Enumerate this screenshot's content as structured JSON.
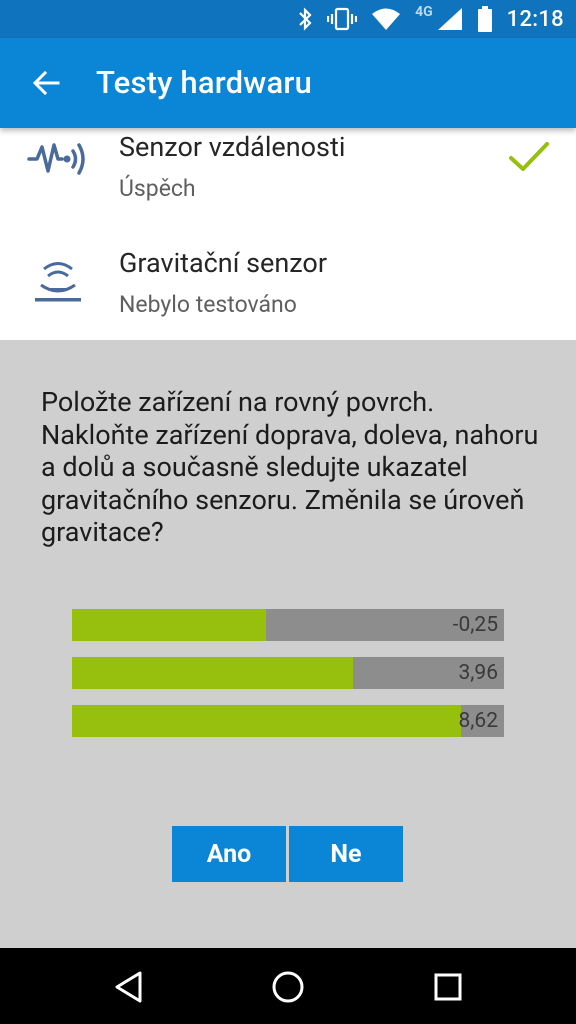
{
  "status_bar": {
    "time": "12:18",
    "network_label": "4G",
    "icons": [
      "bluetooth-icon",
      "vibrate-icon",
      "wifi-icon",
      "signal-icon",
      "battery-icon"
    ]
  },
  "app_bar": {
    "title": "Testy hardwaru",
    "back_icon": "arrow-left-icon"
  },
  "tests": [
    {
      "title": "Senzor vzdálenosti",
      "status": "Úspěch",
      "icon": "proximity-sensor-icon",
      "passed": true
    },
    {
      "title": "Gravitační senzor",
      "status": "Nebylo testováno",
      "icon": "gravity-sensor-icon",
      "passed": false
    }
  ],
  "dialog": {
    "instructions": "Položte zařízení na rovný povrch. Nakloňte zařízení doprava, doleva, nahoru a dolů a současně sledujte ukazatel gravitačního senzoru. Změnila se úroveň gravitace?",
    "readings": [
      {
        "label": "-0,25",
        "fill_fraction": 0.45
      },
      {
        "label": "3,96",
        "fill_fraction": 0.65
      },
      {
        "label": "8,62",
        "fill_fraction": 0.9
      }
    ],
    "yes_label": "Ano",
    "no_label": "Ne"
  },
  "colors": {
    "status_bar": "#0f74bd",
    "app_bar": "#0b86d6",
    "accent_green": "#97bf0d",
    "bar_track": "#8d8d8d",
    "sensor_icon": "#4a6a9b"
  },
  "nav_bar": {
    "icons": [
      "back-triangle-icon",
      "home-circle-icon",
      "recents-square-icon"
    ]
  }
}
